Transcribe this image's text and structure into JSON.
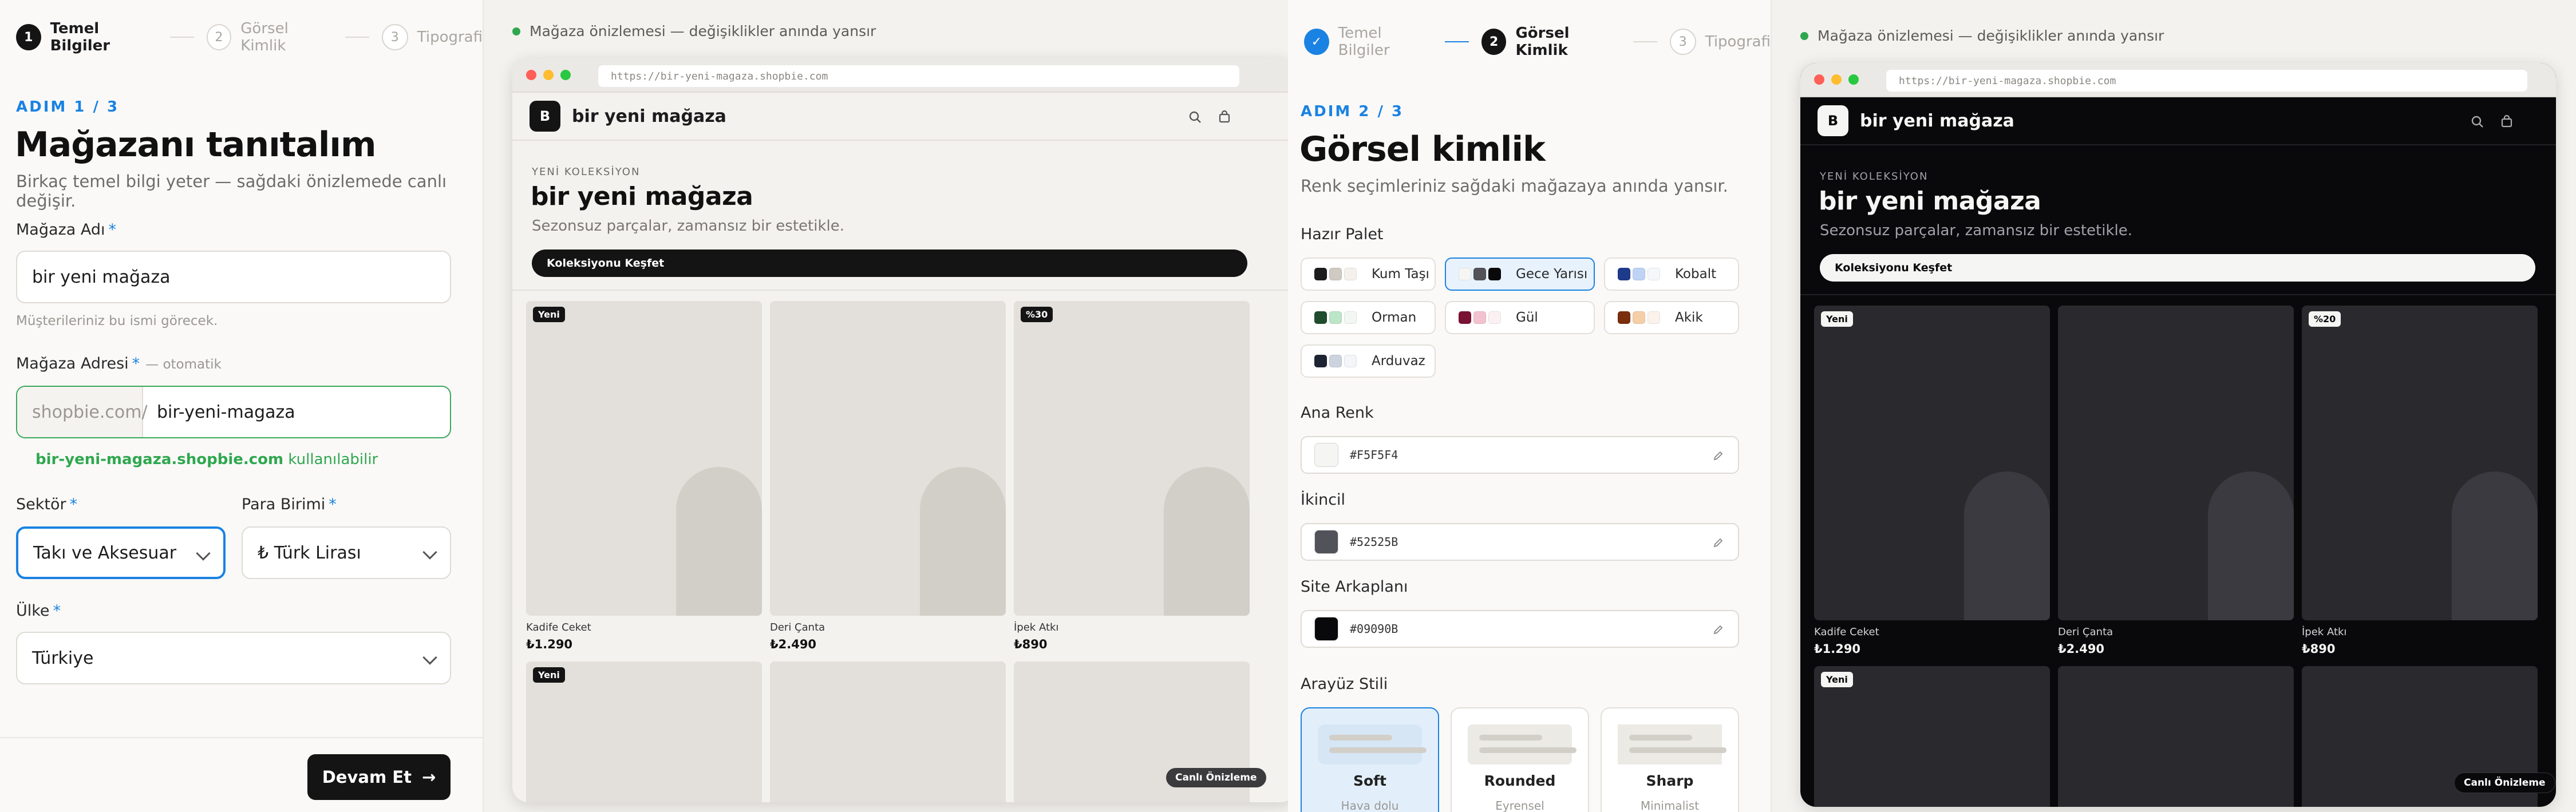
{
  "screen1": {
    "steps": [
      {
        "num": "1",
        "label": "Temel Bilgiler"
      },
      {
        "num": "2",
        "label": "Görsel Kimlik"
      },
      {
        "num": "3",
        "label": "Tipografi"
      }
    ],
    "eyebrow": "ADIM 1 / 3",
    "title": "Mağazanı tanıtalım",
    "subtitle": "Birkaç temel bilgi yeter — sağdaki önizlemede canlı değişir.",
    "store_name": {
      "label": "Mağaza Adı",
      "value": "bir yeni mağaza",
      "hint": "Müşterileriniz bu ismi görecek."
    },
    "store_address": {
      "label": "Mağaza Adresi",
      "auto": "— otomatik",
      "prefix": "shopbie.com/",
      "value": "bir-yeni-magaza",
      "ok_domain": "bir-yeni-magaza.shopbie.com",
      "ok_text": "kullanılabilir"
    },
    "sector": {
      "label": "Sektör",
      "value": "Takı ve Aksesuar"
    },
    "currency": {
      "label": "Para Birimi",
      "value": "₺ Türk Lirası"
    },
    "country": {
      "label": "Ülke",
      "value": "Türkiye"
    },
    "required_mark": "*",
    "continue_button": "Devam Et",
    "arrow": "→"
  },
  "screen2": {
    "steps": [
      {
        "num": "✓",
        "label": "Temel Bilgiler"
      },
      {
        "num": "2",
        "label": "Görsel Kimlik"
      },
      {
        "num": "3",
        "label": "Tipografi"
      }
    ],
    "eyebrow": "ADIM 2 / 3",
    "title": "Görsel kimlik",
    "subtitle": "Renk seçimleriniz sağdaki mağazaya anında yansır.",
    "palette_label": "Hazır Palet",
    "palettes": [
      {
        "name": "Kum Taşı",
        "colors": [
          "#1c1c1c",
          "#cfcac2",
          "#f4f1ec"
        ]
      },
      {
        "name": "Gece Yarısı",
        "colors": [
          "#f5f5f4",
          "#525258",
          "#09090b"
        ],
        "selected": true
      },
      {
        "name": "Kobalt",
        "colors": [
          "#1e3a8a",
          "#bfd3f5",
          "#f5f7fb"
        ]
      },
      {
        "name": "Orman",
        "colors": [
          "#1f4d2e",
          "#bde5c8",
          "#f2f7f3"
        ]
      },
      {
        "name": "Gül",
        "colors": [
          "#7a1233",
          "#f3c2cf",
          "#fbf1f3"
        ]
      },
      {
        "name": "Akik",
        "colors": [
          "#7a2e0d",
          "#f5cfa8",
          "#fbf3eb"
        ]
      },
      {
        "name": "Arduvaz",
        "colors": [
          "#1f2433",
          "#cdd3de",
          "#f4f5f8"
        ]
      }
    ],
    "primary": {
      "label": "Ana Renk",
      "value": "#F5F5F4"
    },
    "secondary": {
      "label": "İkincil",
      "value": "#52525B"
    },
    "background": {
      "label": "Site Arkaplanı",
      "value": "#09090B"
    },
    "ui_style_label": "Arayüz Stili",
    "ui_styles": [
      {
        "name": "Soft",
        "desc": "Hava dolu"
      },
      {
        "name": "Rounded",
        "desc": "Eyrensel"
      },
      {
        "name": "Sharp",
        "desc": "Minimalist"
      }
    ]
  },
  "preview": {
    "note": "Mağaza önizlemesi — değişiklikler anında yansır",
    "url": "https://bir-yeni-magaza.shopbie.com",
    "logo_letter": "B",
    "shop_name": "bir yeni mağaza",
    "kicker": "YENİ KOLEKSİYON",
    "hero_title": "bir yeni mağaza",
    "hero_sub": "Sezonsuz parçalar, zamansız bir estetikle.",
    "cta": "Koleksiyonu Keşfet",
    "products": [
      {
        "badge": "Yeni",
        "name": "Kadife Ceket",
        "price": "₺1.290"
      },
      {
        "badge": "",
        "name": "Deri Çanta",
        "price": "₺2.490"
      },
      {
        "badge_light": "%30",
        "badge_dark": "%20",
        "name": "İpek Atkı",
        "price": "₺890"
      }
    ],
    "row2_badge": "Yeni",
    "live_label": "Canlı Önizleme"
  },
  "colors": {
    "accent": "#1a82e2",
    "success": "#2fa74f",
    "light_bg": "#f4f2ee",
    "dark_bg": "#09090b"
  }
}
